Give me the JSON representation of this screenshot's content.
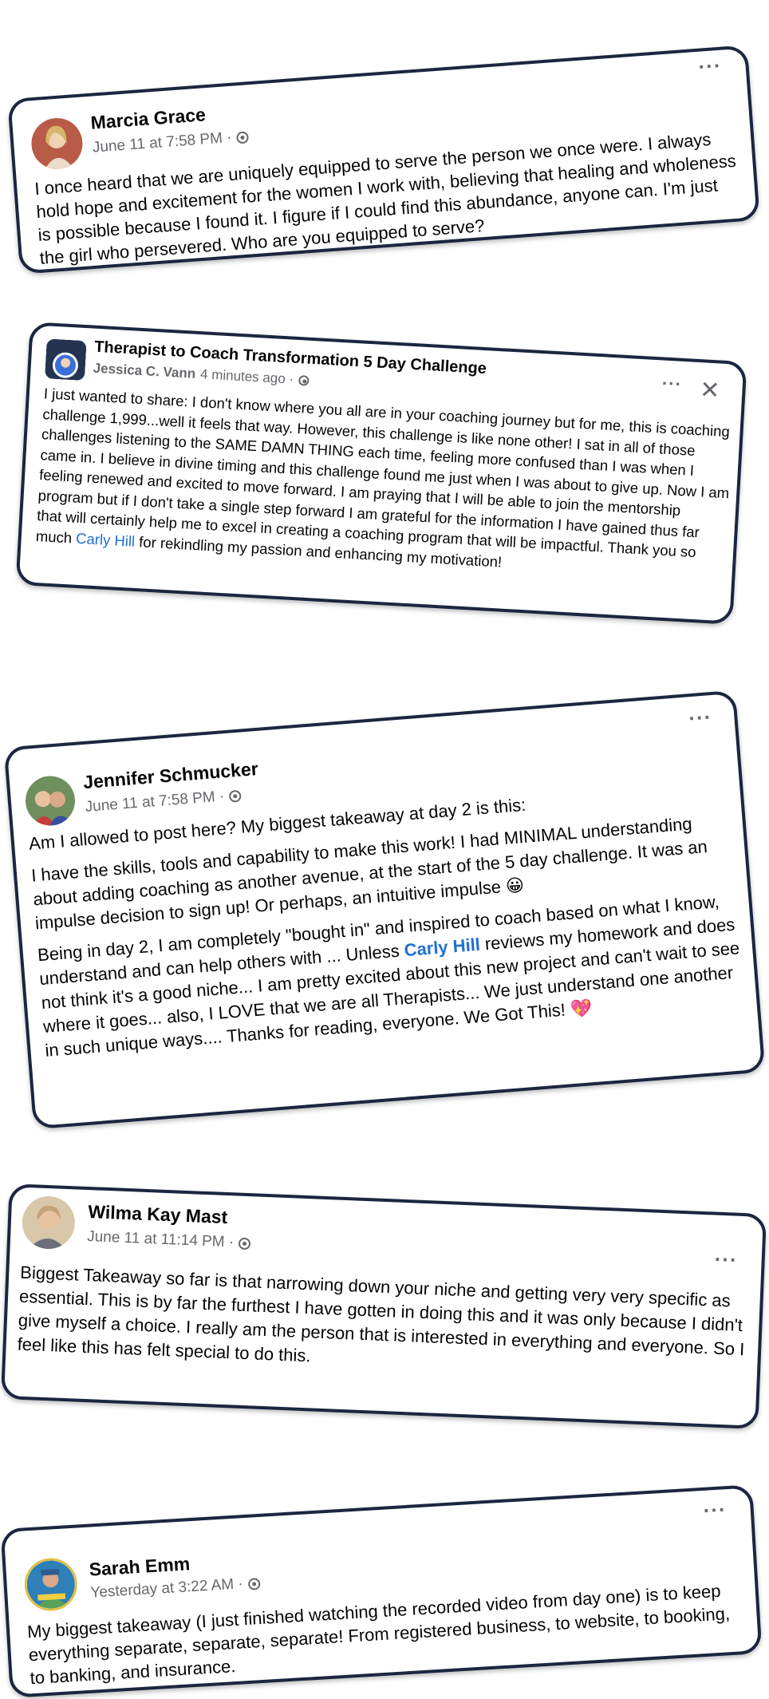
{
  "posts": [
    {
      "author": "Marcia Grace",
      "time": "June 11 at 7:58 PM ·",
      "paragraphs": [
        "I once heard that we are uniquely equipped to serve the person we once were.  I always hold hope and excitement for the women I work with, believing that healing and wholeness is possible because I found it.  I figure if I could find this abundance, anyone can.  I'm just the girl who persevered.  Who are you equipped to serve?"
      ]
    },
    {
      "group": "Therapist to Coach Transformation 5 Day Challenge",
      "author": "Jessica C. Vann",
      "time": "4 minutes ago ·",
      "text_before_link": "I just wanted to share: I don't know where you all are in your coaching journey but for me, this is coaching challenge 1,999...well it feels that way. However, this challenge is like none other! I sat in all of those challenges listening to the SAME DAMN THING each time, feeling more confused than I was when I came in. I believe in divine timing and this challenge found me just when I was about to give up. Now I am feeling renewed and excited to move forward. I am praying that I will be able to join the mentorship program but if I don't take a single step forward I am grateful for the information I have gained thus far that will certainly help me to excel in creating a coaching program that will be impactful. Thank you so much",
      "link": "Carly Hill",
      "text_after_link": "for rekindling my passion and enhancing my motivation!"
    },
    {
      "author": "Jennifer Schmucker",
      "time": "June 11 at 7:58 PM ·",
      "p1": "Am I allowed to post here? My biggest takeaway at day 2 is this:",
      "p2": "I have the skills, tools and capability to make this work! I had MINIMAL understanding about adding coaching as another avenue, at the start of the 5 day challenge. It was an impulse decision to sign up! Or perhaps, an intuitive impulse",
      "emoji1": "😀",
      "p3_before": "Being in day 2, I am completely \"bought in\" and inspired to coach based on what I know, understand and can help others with ... Unless",
      "link": "Carly Hill",
      "p3_after": "reviews my homework and does not think it's a good niche...  I am pretty excited about this new project and can't wait to see where it goes... also, I LOVE that we are all Therapists... We just understand one another in such unique ways.... Thanks for reading, everyone. We Got This!",
      "emoji2": "💖"
    },
    {
      "author": "Wilma Kay Mast",
      "time": "June 11 at 11:14 PM ·",
      "paragraphs": [
        "Biggest Takeaway so far is that narrowing down your niche and getting very very specific as essential. This is by far the furthest I have gotten in doing this and it was only because I didn't give myself a choice. I really am the person that is interested in everything and everyone. So I feel like this has felt special to do this."
      ]
    },
    {
      "author": "Sarah Emm",
      "time": "Yesterday at 3:22 AM ·",
      "paragraphs": [
        "My biggest takeaway (I just finished watching the recorded video from day one) is to keep everything separate, separate, separate! From registered business, to website, to booking, to banking, and insurance."
      ]
    }
  ],
  "icons": {
    "more": "more-horizontal-icon",
    "close": "close-icon",
    "privacy": "globe-icon"
  },
  "colors": {
    "border": "#1c2541",
    "link": "#1f6fd1",
    "meta": "#65676b"
  }
}
